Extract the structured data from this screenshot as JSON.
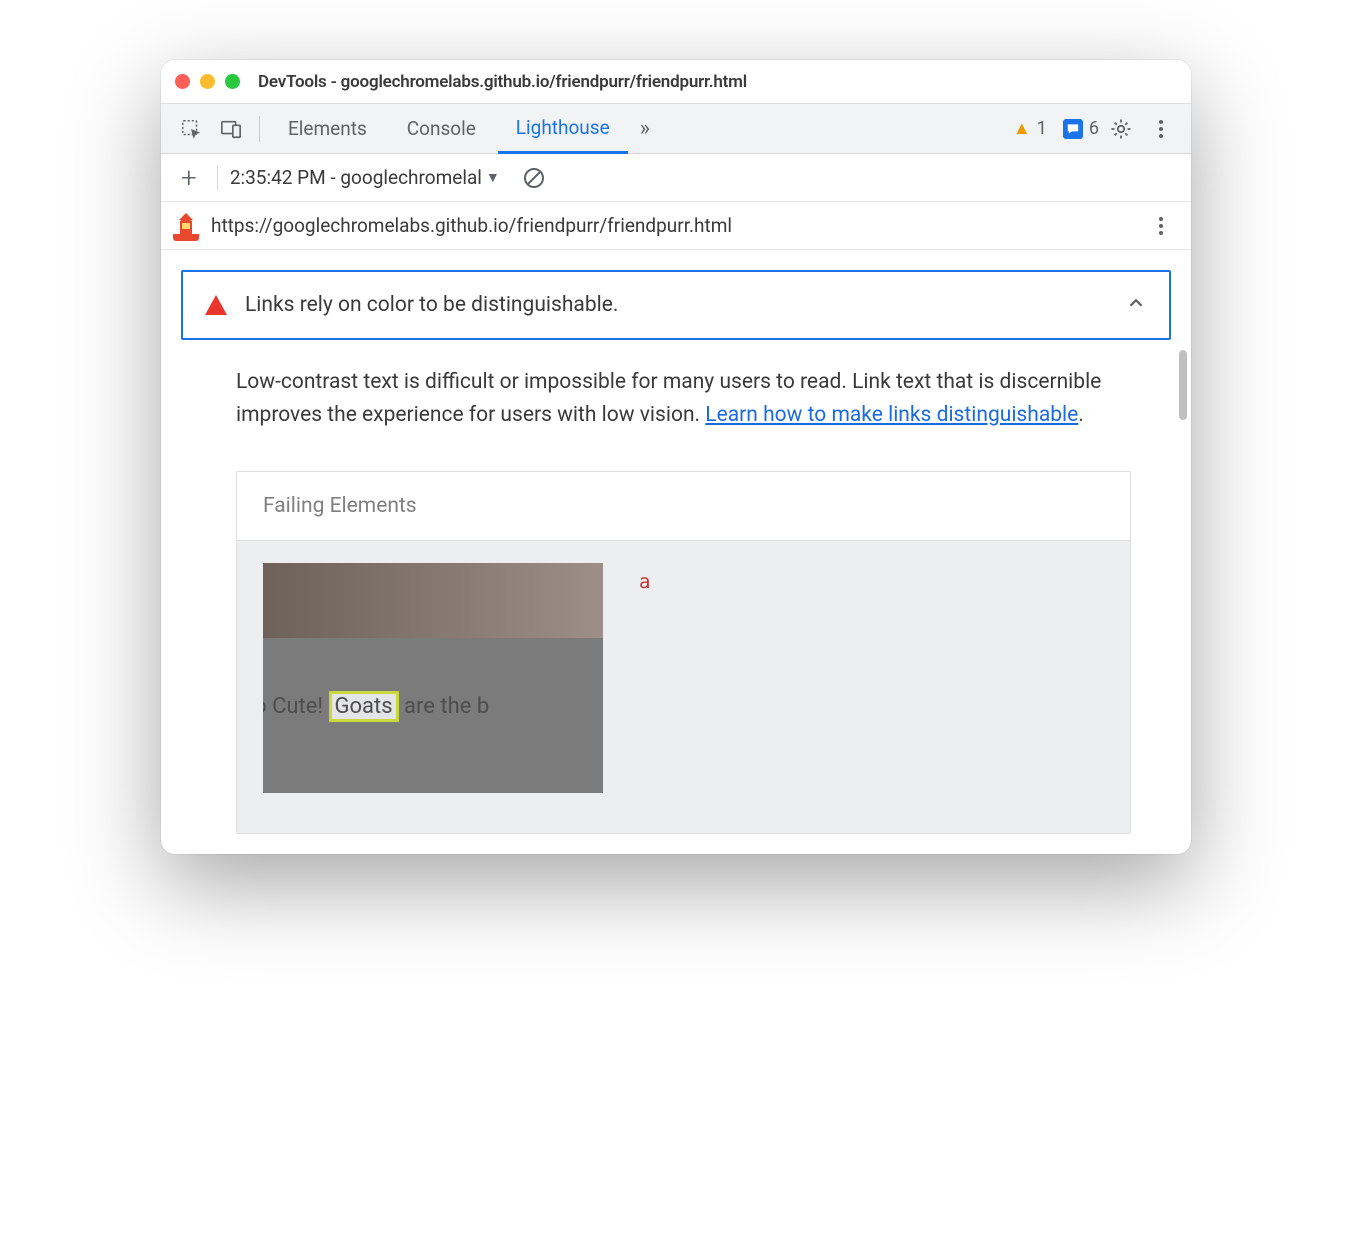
{
  "window": {
    "title": "DevTools - googlechromelabs.github.io/friendpurr/friendpurr.html"
  },
  "tabs": {
    "elements": "Elements",
    "console": "Console",
    "lighthouse": "Lighthouse"
  },
  "badges": {
    "warnings": "1",
    "messages": "6"
  },
  "subbar": {
    "run_label": "2:35:42 PM - googlechromelal"
  },
  "url": "https://googlechromelabs.github.io/friendpurr/friendpurr.html",
  "audit": {
    "title": "Links rely on color to be distinguishable.",
    "description_pre": "Low-contrast text is difficult or impossible for many users to read. Link text that is discernible improves the experience for users with low vision. ",
    "learn_link": "Learn how to make links distinguishable",
    "description_post": "."
  },
  "failing": {
    "header": "Failing Elements",
    "element_tag": "a",
    "caption_pre": "So Cute! ",
    "caption_hi": "Goats",
    "caption_post": " are the b"
  }
}
